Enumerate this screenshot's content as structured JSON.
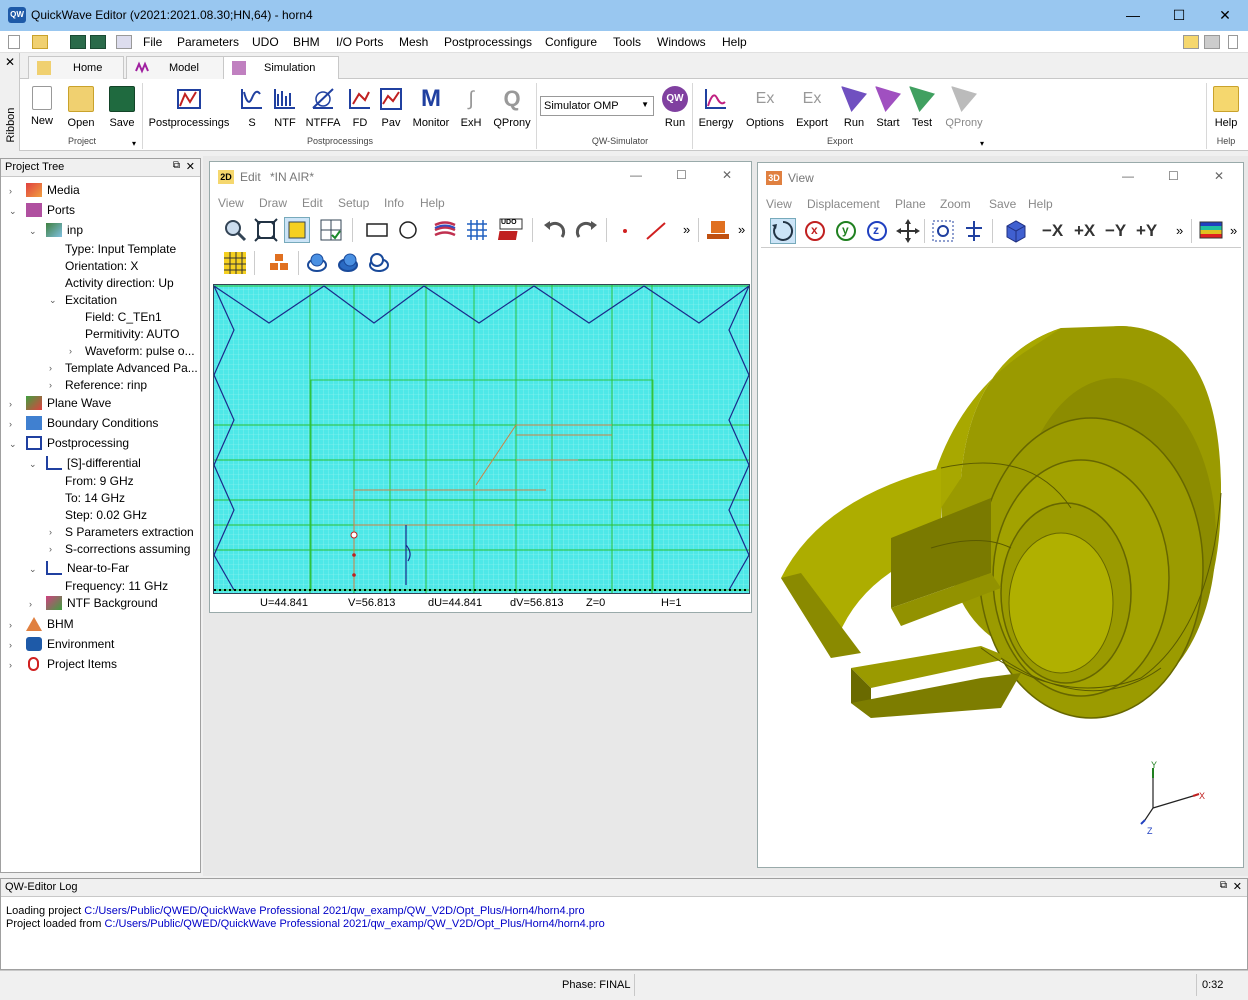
{
  "window": {
    "title": "QuickWave Editor (v2021:2021.08.30;HN,64) - horn4",
    "app_icon_text": "QW",
    "minimize": "—",
    "maximize": "☐",
    "close": "✕"
  },
  "menubar": {
    "items": [
      "File",
      "Parameters",
      "UDO",
      "BHM",
      "I/O Ports",
      "Mesh",
      "Postprocessings",
      "Configure",
      "Tools",
      "Windows",
      "Help"
    ]
  },
  "ribbon": {
    "side_label": "Ribbon",
    "tabs": [
      "Home",
      "Model",
      "Simulation"
    ],
    "project_buttons": [
      "New",
      "Open",
      "Save"
    ],
    "project_group": "Project",
    "postproc_buttons": [
      "Postprocessings",
      "S",
      "NTF",
      "NTFFA",
      "FD",
      "Pav",
      "Monitor",
      "ExH",
      "QProny"
    ],
    "postproc_group": "Postprocessings",
    "simulator_select": "Simulator OMP",
    "run_button": "Run",
    "qwsim_group": "QW-Simulator",
    "export_buttons": [
      "Energy",
      "Options",
      "Export",
      "Run",
      "Start",
      "Test",
      "QProny"
    ],
    "export_group": "Export",
    "help_button": "Help",
    "help_group": "Help"
  },
  "project_tree": {
    "title": "Project Tree",
    "rows": [
      {
        "label": "Media"
      },
      {
        "label": "Ports"
      },
      {
        "label": "inp"
      },
      {
        "label": "Type: Input Template"
      },
      {
        "label": "Orientation: X"
      },
      {
        "label": "Activity direction: Up"
      },
      {
        "label": "Excitation"
      },
      {
        "label": "Field: C_TEn1"
      },
      {
        "label": "Permitivity: AUTO"
      },
      {
        "label": "Waveform: pulse o..."
      },
      {
        "label": "Template Advanced Pa..."
      },
      {
        "label": "Reference: rinp"
      },
      {
        "label": "Plane Wave"
      },
      {
        "label": "Boundary Conditions"
      },
      {
        "label": "Postprocessing"
      },
      {
        "label": "[S]-differential"
      },
      {
        "label": "From: 9 GHz"
      },
      {
        "label": "To: 14 GHz"
      },
      {
        "label": "Step: 0.02 GHz"
      },
      {
        "label": "S Parameters extraction"
      },
      {
        "label": "S-corrections assuming"
      },
      {
        "label": "Near-to-Far"
      },
      {
        "label": "Frequency: 11 GHz"
      },
      {
        "label": "NTF Background"
      },
      {
        "label": "BHM"
      },
      {
        "label": "Environment"
      },
      {
        "label": "Project Items"
      }
    ]
  },
  "edit_window": {
    "badge": "2D",
    "title": "Edit",
    "subtitle": "*IN AIR*",
    "menu": [
      "View",
      "Draw",
      "Edit",
      "Setup",
      "Info",
      "Help"
    ],
    "udo_badge": "UDO",
    "more": "»",
    "status": {
      "u": "U=44.841",
      "v": "V=56.813",
      "du": "dU=44.841",
      "dv": "dV=56.813",
      "z": "Z=0",
      "h": "H=1"
    }
  },
  "view_window": {
    "badge": "3D",
    "title": "View",
    "menu": [
      "View",
      "Displacement",
      "Plane",
      "Zoom",
      "Save",
      "Help"
    ],
    "axis_buttons": [
      "−X",
      "+X",
      "−Y",
      "+Y"
    ],
    "rot_labels": [
      "x",
      "y",
      "z"
    ],
    "more": "»",
    "axes": {
      "x": "X",
      "y": "Y",
      "z": "Z"
    }
  },
  "log": {
    "title": "QW-Editor Log",
    "lines": [
      {
        "prefix": "Loading project ",
        "path": "C:/Users/Public/QWED/QuickWave Professional 2021/qw_examp/QW_V2D/Opt_Plus/Horn4/horn4.pro"
      },
      {
        "prefix": "Project loaded from ",
        "path": "C:/Users/Public/QWED/QuickWave Professional 2021/qw_examp/QW_V2D/Opt_Plus/Horn4/horn4.pro"
      }
    ]
  },
  "statusbar": {
    "phase": "Phase: FINAL",
    "time": "0:32"
  },
  "colors": {
    "accent": "#99c7f0",
    "mesh_bg": "#4ee8e8",
    "model": "#8c8c00",
    "link": "#0000c8"
  }
}
